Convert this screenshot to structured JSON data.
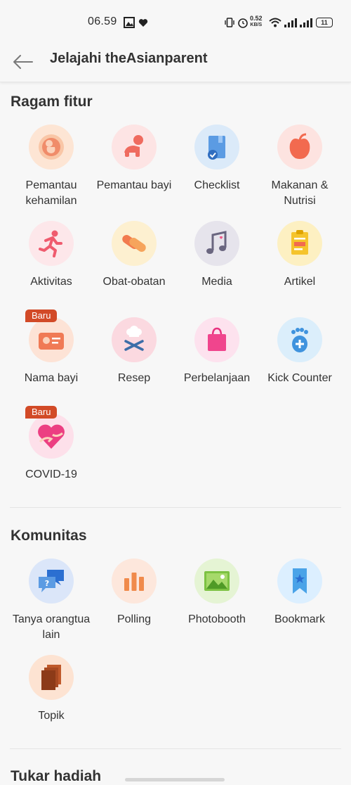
{
  "status_bar": {
    "time": "06.59",
    "net_speed_value": "0.52",
    "net_speed_unit": "KB/S",
    "battery": "11"
  },
  "header": {
    "title": "Jelajahi theAsianparent"
  },
  "sections": {
    "fitur": {
      "title": "Ragam fitur",
      "items": [
        {
          "label": "Pemantau kehamilan",
          "icon": "fetus-icon",
          "bg": "#fde5d4"
        },
        {
          "label": "Pemantau bayi",
          "icon": "crawling-baby-icon",
          "bg": "#fde4e4"
        },
        {
          "label": "Checklist",
          "icon": "checklist-icon",
          "bg": "#dbeaf9"
        },
        {
          "label": "Makanan & Nutrisi",
          "icon": "apple-icon",
          "bg": "#fde3e0"
        },
        {
          "label": "Aktivitas",
          "icon": "running-icon",
          "bg": "#fde7ea"
        },
        {
          "label": "Obat-obatan",
          "icon": "pill-icon",
          "bg": "#fdf0d0"
        },
        {
          "label": "Media",
          "icon": "music-note-icon",
          "bg": "#e6e4ec"
        },
        {
          "label": "Artikel",
          "icon": "clipboard-icon",
          "bg": "#fdf0c2"
        },
        {
          "label": "Nama bayi",
          "icon": "name-badge-icon",
          "bg": "#fde3d6",
          "badge": "Baru"
        },
        {
          "label": "Resep",
          "icon": "chef-icon",
          "bg": "#fbd9e0"
        },
        {
          "label": "Perbelanjaan",
          "icon": "shopping-bag-icon",
          "bg": "#fde2ee"
        },
        {
          "label": "Kick Counter",
          "icon": "footprint-icon",
          "bg": "#dbeefb"
        },
        {
          "label": "COVID-19",
          "icon": "heart-hands-icon",
          "bg": "#fde0ea",
          "badge": "Baru"
        }
      ]
    },
    "komunitas": {
      "title": "Komunitas",
      "items": [
        {
          "label": "Tanya orangtua lain",
          "icon": "chat-question-icon",
          "bg": "#dbe6f9"
        },
        {
          "label": "Polling",
          "icon": "bar-chart-icon",
          "bg": "#fde7dc"
        },
        {
          "label": "Photobooth",
          "icon": "image-icon",
          "bg": "#e5f4d4"
        },
        {
          "label": "Bookmark",
          "icon": "bookmark-icon",
          "bg": "#dcefff"
        },
        {
          "label": "Topik",
          "icon": "stacked-pages-icon",
          "bg": "#fde3d2"
        }
      ]
    },
    "hadiah": {
      "title": "Tukar hadiah"
    }
  }
}
